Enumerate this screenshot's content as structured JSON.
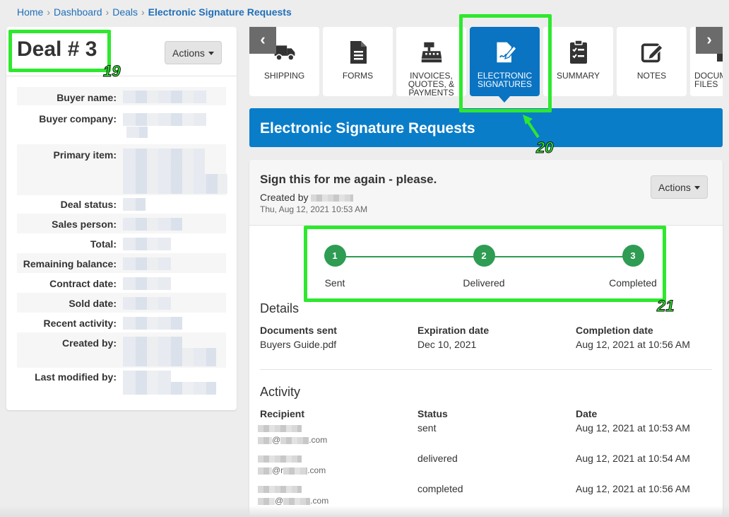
{
  "breadcrumb": {
    "items": [
      "Home",
      "Dashboard",
      "Deals"
    ],
    "current": "Electronic Signature Requests"
  },
  "deal": {
    "title": "Deal # 3",
    "actions_label": "Actions",
    "fields": [
      {
        "label": "Buyer name:"
      },
      {
        "label": "Buyer company:"
      },
      {
        "label": "Primary item:"
      },
      {
        "label": "Deal status:"
      },
      {
        "label": "Sales person:"
      },
      {
        "label": "Total:"
      },
      {
        "label": "Remaining balance:"
      },
      {
        "label": "Contract date:"
      },
      {
        "label": "Sold date:"
      },
      {
        "label": "Recent activity:"
      },
      {
        "label": "Created by:"
      },
      {
        "label": "Last modified by:"
      }
    ]
  },
  "tabs": {
    "prev_arrow": "‹",
    "next_arrow": "›",
    "items": [
      {
        "label": "SHIPPING",
        "icon": "truck-icon"
      },
      {
        "label": "FORMS",
        "icon": "document-icon"
      },
      {
        "label": "INVOICES, QUOTES, & PAYMENTS",
        "icon": "cash-register-icon"
      },
      {
        "label": "ELECTRONIC SIGNATURES",
        "icon": "signature-icon",
        "active": true
      },
      {
        "label": "SUMMARY",
        "icon": "clipboard-check-icon"
      },
      {
        "label": "NOTES",
        "icon": "edit-note-icon"
      },
      {
        "label": "DOCUMENT FILES",
        "icon": "folder-icon"
      }
    ]
  },
  "section": {
    "title": "Electronic Signature Requests"
  },
  "request": {
    "title": "Sign this for me again - please.",
    "created_by_label": "Created by",
    "created_date": "Thu, Aug 12, 2021 10:53 AM",
    "actions_label": "Actions",
    "steps": [
      {
        "number": "1",
        "label": "Sent"
      },
      {
        "number": "2",
        "label": "Delivered"
      },
      {
        "number": "3",
        "label": "Completed"
      }
    ],
    "details": {
      "heading": "Details",
      "columns": [
        {
          "header": "Documents sent",
          "value": "Buyers Guide.pdf"
        },
        {
          "header": "Expiration date",
          "value": "Dec 10, 2021"
        },
        {
          "header": "Completion date",
          "value": "Aug 12, 2021 at 10:56 AM"
        }
      ]
    },
    "activity": {
      "heading": "Activity",
      "headers": [
        "Recipient",
        "Status",
        "Date"
      ],
      "rows": [
        {
          "email_frag_1": "@",
          "email_frag_2": ".com",
          "status": "sent",
          "date": "Aug 12, 2021 at 10:53 AM"
        },
        {
          "email_frag_1": "@r",
          "email_frag_2": ".com",
          "status": "delivered",
          "date": "Aug 12, 2021 at 10:54 AM"
        },
        {
          "email_frag_1": "@",
          "email_frag_2": ".com",
          "status": "completed",
          "date": "Aug 12, 2021 at 10:56 AM"
        }
      ]
    }
  },
  "annotations": {
    "n1": "19",
    "n2": "20",
    "n3": "21"
  },
  "colors": {
    "accent": "#0a7dc9",
    "success": "#2e9c52",
    "callout": "#2ee82e"
  }
}
